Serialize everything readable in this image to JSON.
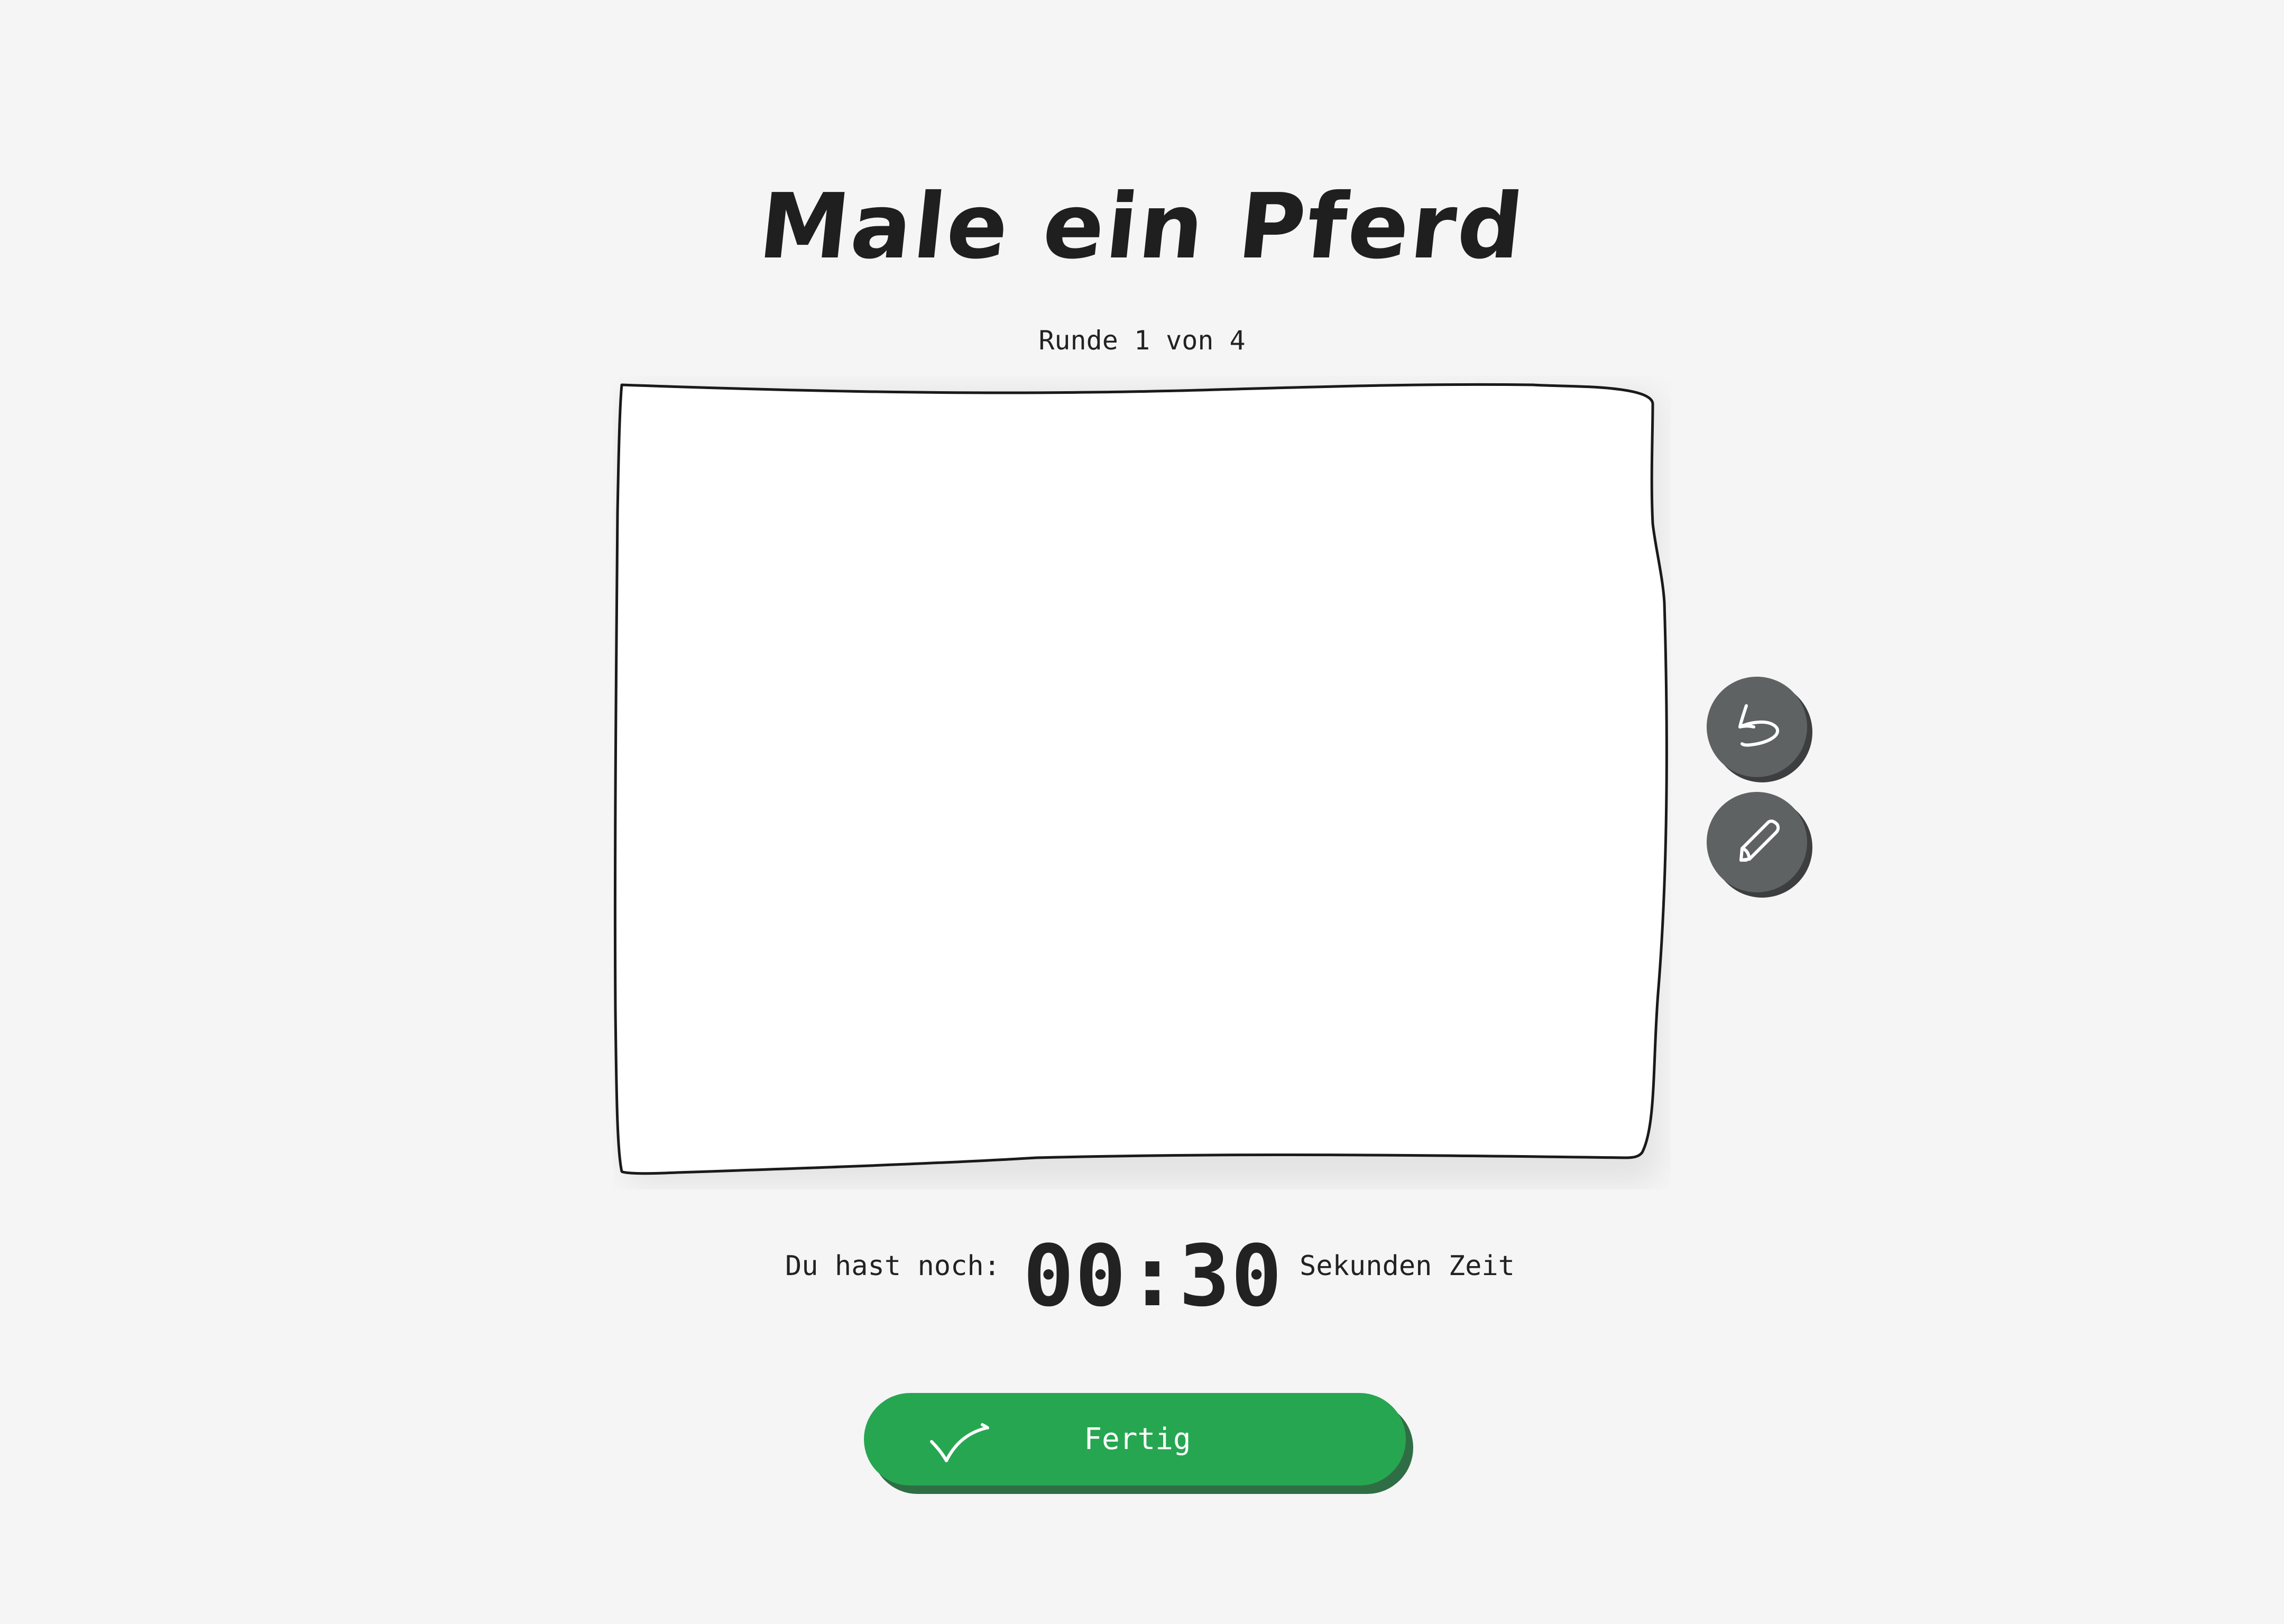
{
  "header": {
    "title": "Male ein Pferd",
    "round": "Runde 1 von 4"
  },
  "tools": {
    "undo_icon": "undo-arrow-icon",
    "pen_icon": "pencil-icon",
    "button_color": "#5f6263"
  },
  "timer": {
    "prefix": "Du hast noch:",
    "value": "00:30",
    "suffix": "Sekunden Zeit"
  },
  "done_button": {
    "label": "Fertig",
    "icon": "checkmark-icon",
    "color": "#27a651"
  }
}
